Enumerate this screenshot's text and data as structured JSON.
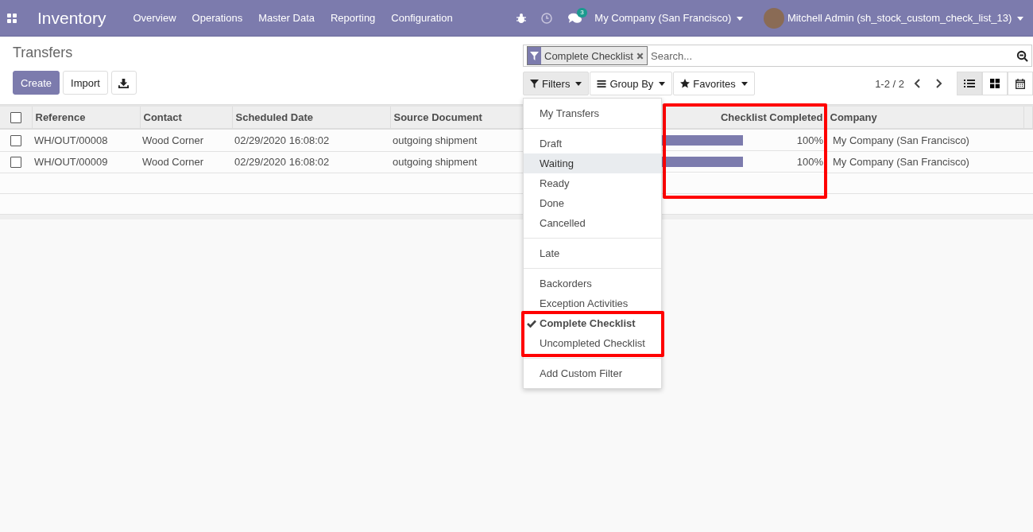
{
  "navbar": {
    "app_name": "Inventory",
    "menu": [
      "Overview",
      "Operations",
      "Master Data",
      "Reporting",
      "Configuration"
    ],
    "messages_badge": "3",
    "company": "My Company (San Francisco)",
    "user": "Mitchell Admin (sh_stock_custom_check_list_13)"
  },
  "page": {
    "title": "Transfers",
    "buttons": [
      "Create",
      "Import"
    ]
  },
  "search": {
    "facet": "Complete Checklist",
    "placeholder": "Search..."
  },
  "search_buttons": [
    {
      "label": "Filters",
      "kind": "filter",
      "selected": true
    },
    {
      "label": "Group By",
      "kind": "bars",
      "selected": false
    },
    {
      "label": "Favorites",
      "kind": "star",
      "selected": false
    }
  ],
  "pager": "1-2 / 2",
  "views": [
    {
      "kind": "list",
      "selected": true
    },
    {
      "kind": "kanban",
      "selected": false
    },
    {
      "kind": "calendar",
      "selected": false
    }
  ],
  "table": {
    "select_all_checked": false,
    "columns": [
      "Reference",
      "Contact",
      "Scheduled Date",
      "Source Document",
      "Checklist Completed",
      "Company"
    ],
    "rows": [
      {
        "checked": false,
        "reference": "WH/OUT/00008",
        "contact": "Wood Corner",
        "date": "02/29/2020 16:08:02",
        "source": "outgoing shipment",
        "level": 1,
        "percent": "100%",
        "company": "My Company (San Francisco)"
      },
      {
        "checked": false,
        "reference": "WH/OUT/00009",
        "contact": "Wood Corner",
        "date": "02/29/2020 16:08:02",
        "source": "outgoing shipment",
        "level": 1,
        "percent": "100%",
        "company": "My Company (San Francisco)"
      }
    ]
  },
  "filters_menu": {
    "groups": [
      [
        {
          "label": "My Transfers",
          "selected": false,
          "hovered": false
        }
      ],
      [
        {
          "label": "Draft",
          "selected": false,
          "hovered": false
        },
        {
          "label": "Waiting",
          "selected": false,
          "hovered": true
        },
        {
          "label": "Ready",
          "selected": false,
          "hovered": false
        },
        {
          "label": "Done",
          "selected": false,
          "hovered": false
        },
        {
          "label": "Cancelled",
          "selected": false,
          "hovered": false
        }
      ],
      [
        {
          "label": "Late",
          "selected": false,
          "hovered": false
        }
      ],
      [
        {
          "label": "Backorders",
          "selected": false,
          "hovered": false
        },
        {
          "label": "Exception Activities",
          "selected": false,
          "hovered": false
        },
        {
          "label": "Complete Checklist",
          "selected": true,
          "hovered": false
        },
        {
          "label": "Uncompleted Checklist",
          "selected": false,
          "hovered": false
        }
      ],
      [
        {
          "label": "Add Custom Filter",
          "selected": false,
          "hovered": false
        }
      ]
    ]
  }
}
